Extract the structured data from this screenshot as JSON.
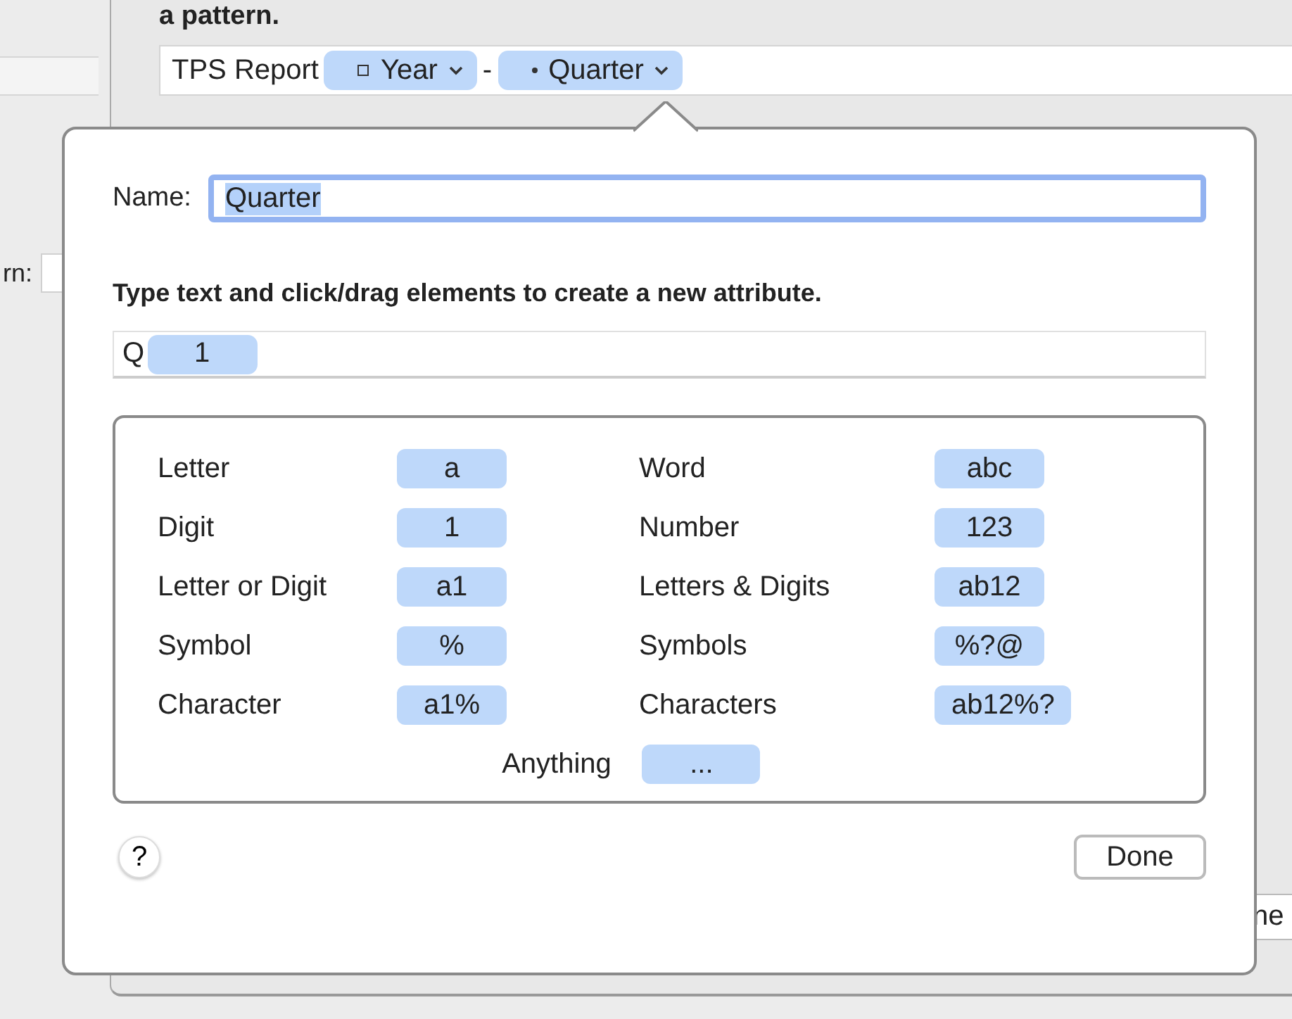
{
  "background": {
    "heading": "a pattern.",
    "pattern": [
      {
        "kind": "text",
        "label": "TPS Report"
      },
      {
        "kind": "square_token",
        "label": "Year"
      },
      {
        "kind": "text",
        "label": "-"
      },
      {
        "kind": "dot_token",
        "label": "Quarter"
      }
    ],
    "side_label": "rn:",
    "partial_button": "ne"
  },
  "popover": {
    "name_label": "Name:",
    "name_value": "Quarter",
    "name_text_selected": true,
    "instruction": "Type text and click/drag elements to create a new attribute.",
    "attribute": [
      {
        "kind": "text",
        "label": "Q"
      },
      {
        "kind": "token",
        "label": "1"
      }
    ],
    "elements": [
      {
        "label": "Letter",
        "token": "a"
      },
      {
        "label": "Word",
        "token": "abc"
      },
      {
        "label": "Digit",
        "token": "1"
      },
      {
        "label": "Number",
        "token": "123"
      },
      {
        "label": "Letter or Digit",
        "token": "a1"
      },
      {
        "label": "Letters & Digits",
        "token": "ab12"
      },
      {
        "label": "Symbol",
        "token": "%"
      },
      {
        "label": "Symbols",
        "token": "%?@"
      },
      {
        "label": "Character",
        "token": "a1%"
      },
      {
        "label": "Characters",
        "token": "ab12%?"
      }
    ],
    "anything": {
      "label": "Anything",
      "token": "..."
    },
    "help": "?",
    "done": "Done"
  }
}
